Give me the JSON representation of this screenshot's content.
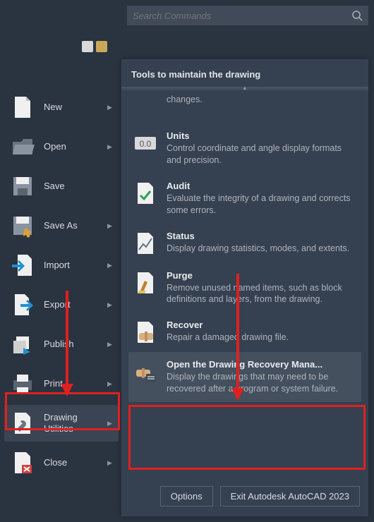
{
  "search": {
    "placeholder": "Search Commands"
  },
  "sidebar": {
    "items": [
      {
        "label": "New",
        "has_sub": true
      },
      {
        "label": "Open",
        "has_sub": true
      },
      {
        "label": "Save",
        "has_sub": false
      },
      {
        "label": "Save As",
        "has_sub": true
      },
      {
        "label": "Import",
        "has_sub": true
      },
      {
        "label": "Export",
        "has_sub": true
      },
      {
        "label": "Publish",
        "has_sub": true
      },
      {
        "label": "Print",
        "has_sub": true
      },
      {
        "label": "Drawing Utilities",
        "has_sub": true
      },
      {
        "label": "Close",
        "has_sub": true
      }
    ]
  },
  "panel": {
    "title": "Tools to maintain the drawing",
    "first_fragment": "changes.",
    "items": [
      {
        "title": "Units",
        "desc": "Control coordinate and angle display formats and precision."
      },
      {
        "title": "Audit",
        "desc": "Evaluate the integrity of a drawing and corrects some errors."
      },
      {
        "title": "Status",
        "desc": "Display drawing statistics, modes, and extents."
      },
      {
        "title": "Purge",
        "desc": "Remove unused named items, such as block definitions and layers, from the drawing."
      },
      {
        "title": "Recover",
        "desc": "Repair a damaged drawing file."
      },
      {
        "title": "Open the Drawing Recovery Mana...",
        "desc": "Display the drawings that may need to be recovered after a program or system failure."
      }
    ]
  },
  "footer": {
    "options": "Options",
    "exit": "Exit Autodesk AutoCAD 2023"
  }
}
